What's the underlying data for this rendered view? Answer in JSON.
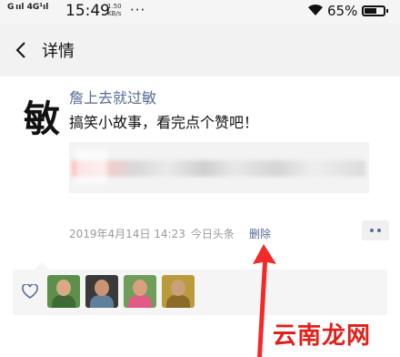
{
  "status_bar": {
    "signal": "G ııl 4G¹ıl",
    "time": "15:49",
    "net_speed_value": "1.50",
    "net_speed_unit": "KB/s",
    "dots": "···",
    "battery_percent": "65%",
    "battery_level": 0.65
  },
  "header": {
    "title": "详情"
  },
  "post": {
    "avatar_char": "敏",
    "author": "詹上去就过敏",
    "text": "搞笑小故事，看完点个赞吧！",
    "date": "2019年4月14日 14:23",
    "source": "今日头条",
    "delete_label": "删除"
  },
  "likes": {
    "avatars": [
      {
        "name": "like-avatar-1",
        "bg": "#5b8f4a",
        "head": "#d9a98a",
        "body": "#3e6b35"
      },
      {
        "name": "like-avatar-2",
        "bg": "#3a3a3a",
        "head": "#c99474",
        "body": "#5f7f9c"
      },
      {
        "name": "like-avatar-3",
        "bg": "#6f9d5a",
        "head": "#d7a080",
        "body": "#e25b86"
      },
      {
        "name": "like-avatar-4",
        "bg": "#b99b3c",
        "head": "#caa07a",
        "body": "#8c6a2a"
      }
    ]
  },
  "watermark": "云南龙网",
  "colors": {
    "link": "#576b95",
    "arrow": "#f22a2a",
    "watermark": "#e0201a"
  }
}
